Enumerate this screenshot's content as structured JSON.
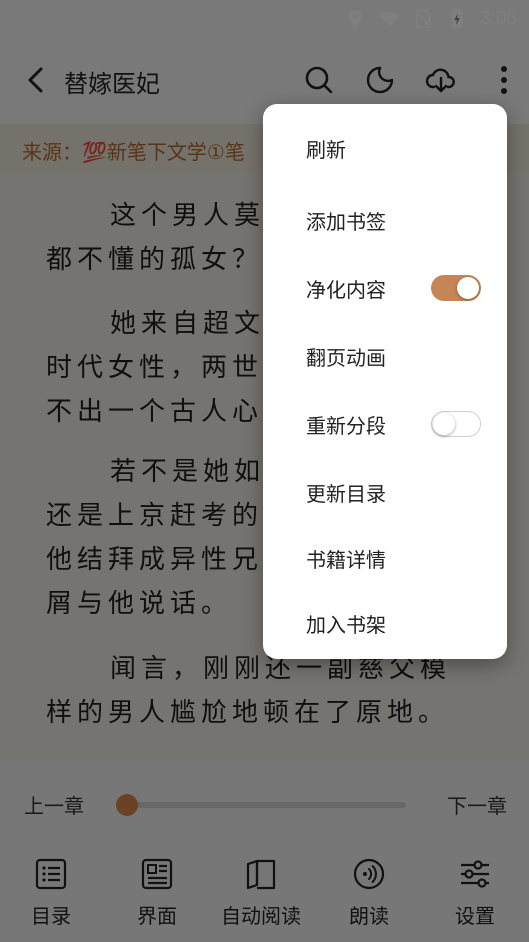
{
  "status_bar": {
    "time": "3:05"
  },
  "app_bar": {
    "title": "替嫁医妃"
  },
  "source_bar": {
    "text": "来源：💯新笔下文学①笔"
  },
  "reader": {
    "paragraphs": [
      {
        "lines": [
          "这个男人莫",
          "都不懂的孤女？"
        ]
      },
      {
        "lines": [
          "她来自超文",
          "时代女性，两世",
          "不出一个古人心"
        ]
      },
      {
        "lines": [
          "若不是她如",
          "还是上京赶考的",
          "他结拜成异性兄",
          "屑与他说话。"
        ]
      },
      {
        "lines": [
          "闻言，刚刚还一副慈父模",
          "样的男人尴尬地顿在了原地。"
        ]
      }
    ]
  },
  "bottom_bar": {
    "prev_chapter": "上一章",
    "next_chapter": "下一章",
    "progress": 0,
    "nav": [
      {
        "label": "目录",
        "icon": "list-icon"
      },
      {
        "label": "界面",
        "icon": "layout-icon"
      },
      {
        "label": "自动阅读",
        "icon": "book-open-icon"
      },
      {
        "label": "朗读",
        "icon": "audio-icon"
      },
      {
        "label": "设置",
        "icon": "sliders-icon"
      }
    ]
  },
  "menu": {
    "items": [
      {
        "label": "刷新"
      },
      {
        "label": "添加书签"
      },
      {
        "label": "净化内容",
        "toggle": true
      },
      {
        "label": "翻页动画"
      },
      {
        "label": "重新分段",
        "toggle": false
      },
      {
        "label": "更新目录"
      },
      {
        "label": "书籍详情"
      },
      {
        "label": "加入书架"
      }
    ]
  },
  "colors": {
    "accent": "#c58557",
    "source_text": "#b4682f"
  }
}
